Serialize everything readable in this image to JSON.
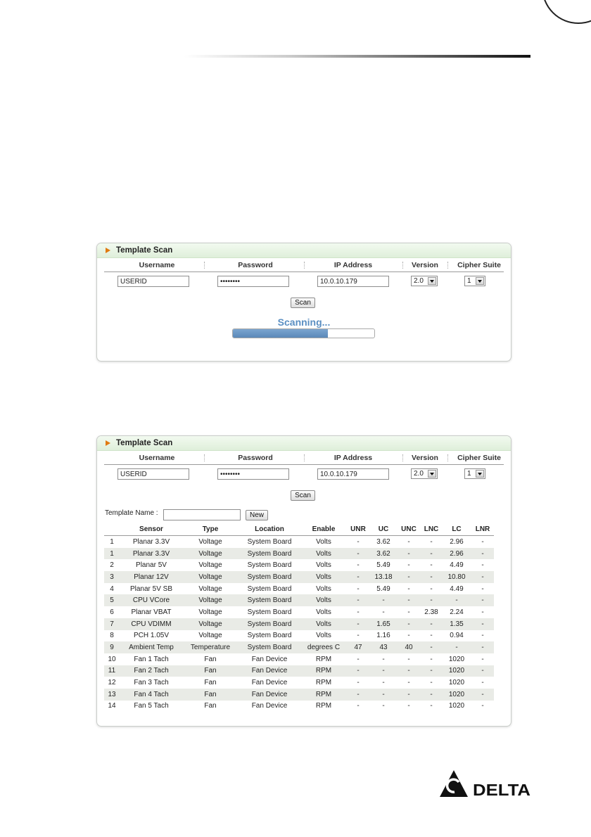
{
  "panel1": {
    "title": "Template Scan",
    "headers": {
      "username": "Username",
      "password": "Password",
      "ip": "IP Address",
      "version": "Version",
      "cipher": "Cipher Suite"
    },
    "username": "USERID",
    "password": "••••••••",
    "ip": "10.0.10.179",
    "version": "2.0",
    "cipher": "1",
    "scan_label": "Scan",
    "status": "Scanning...",
    "progress_percent": 67
  },
  "panel2": {
    "title": "Template Scan",
    "headers": {
      "username": "Username",
      "password": "Password",
      "ip": "IP Address",
      "version": "Version",
      "cipher": "Cipher Suite"
    },
    "username": "USERID",
    "password": "••••••••",
    "ip": "10.0.10.179",
    "version": "2.0",
    "cipher": "1",
    "scan_label": "Scan",
    "template_label": "Template Name :",
    "template_value": "",
    "new_label": "New",
    "columns": [
      "",
      "Sensor",
      "Type",
      "Location",
      "Enable",
      "UNR",
      "UC",
      "UNC",
      "LNC",
      "LC",
      "LNR"
    ],
    "rows": [
      [
        "1",
        "Planar 3.3V",
        "Voltage",
        "System Board",
        "Volts",
        "-",
        "3.62",
        "-",
        "-",
        "2.96",
        "-"
      ],
      [
        "1",
        "Planar 3.3V",
        "Voltage",
        "System Board",
        "Volts",
        "-",
        "3.62",
        "-",
        "-",
        "2.96",
        "-"
      ],
      [
        "2",
        "Planar 5V",
        "Voltage",
        "System Board",
        "Volts",
        "-",
        "5.49",
        "-",
        "-",
        "4.49",
        "-"
      ],
      [
        "3",
        "Planar 12V",
        "Voltage",
        "System Board",
        "Volts",
        "-",
        "13.18",
        "-",
        "-",
        "10.80",
        "-"
      ],
      [
        "4",
        "Planar 5V SB",
        "Voltage",
        "System Board",
        "Volts",
        "-",
        "5.49",
        "-",
        "-",
        "4.49",
        "-"
      ],
      [
        "5",
        "CPU VCore",
        "Voltage",
        "System Board",
        "Volts",
        "-",
        "-",
        "-",
        "-",
        "-",
        "-"
      ],
      [
        "6",
        "Planar VBAT",
        "Voltage",
        "System Board",
        "Volts",
        "-",
        "-",
        "-",
        "2.38",
        "2.24",
        "-"
      ],
      [
        "7",
        "CPU VDIMM",
        "Voltage",
        "System Board",
        "Volts",
        "-",
        "1.65",
        "-",
        "-",
        "1.35",
        "-"
      ],
      [
        "8",
        "PCH 1.05V",
        "Voltage",
        "System Board",
        "Volts",
        "-",
        "1.16",
        "-",
        "-",
        "0.94",
        "-"
      ],
      [
        "9",
        "Ambient Temp",
        "Temperature",
        "System Board",
        "degrees C",
        "47",
        "43",
        "40",
        "-",
        "-",
        "-"
      ],
      [
        "10",
        "Fan 1 Tach",
        "Fan",
        "Fan Device",
        "RPM",
        "-",
        "-",
        "-",
        "-",
        "1020",
        "-"
      ],
      [
        "11",
        "Fan 2 Tach",
        "Fan",
        "Fan Device",
        "RPM",
        "-",
        "-",
        "-",
        "-",
        "1020",
        "-"
      ],
      [
        "12",
        "Fan 3 Tach",
        "Fan",
        "Fan Device",
        "RPM",
        "-",
        "-",
        "-",
        "-",
        "1020",
        "-"
      ],
      [
        "13",
        "Fan 4 Tach",
        "Fan",
        "Fan Device",
        "RPM",
        "-",
        "-",
        "-",
        "-",
        "1020",
        "-"
      ],
      [
        "14",
        "Fan 5 Tach",
        "Fan",
        "Fan Device",
        "RPM",
        "-",
        "-",
        "-",
        "-",
        "1020",
        "-"
      ]
    ]
  },
  "logo": {
    "text": "DELTA"
  }
}
